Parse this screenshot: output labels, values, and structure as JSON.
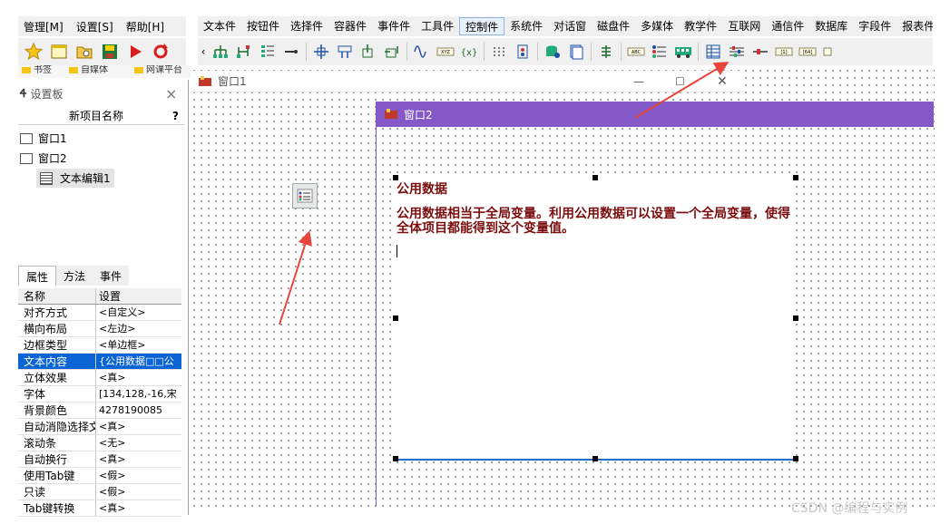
{
  "left_menu": [
    "管理[M]",
    "设置[S]",
    "帮助[H]"
  ],
  "left_toolbar_icons": [
    "star-icon",
    "window-icon",
    "open-folder-icon",
    "save-icon",
    "run-icon",
    "refresh-icon"
  ],
  "fav_strip": {
    "items": [
      "书签",
      "自媒体",
      "网课平台"
    ]
  },
  "main_menu": [
    "文本件",
    "按钮件",
    "选择件",
    "容器件",
    "事件件",
    "工具件",
    "控制件",
    "系统件",
    "对话窗",
    "磁盘件",
    "多媒体",
    "教学件",
    "互联网",
    "通信件",
    "数据库",
    "字段件",
    "报表件"
  ],
  "main_menu_active": "控制件",
  "panel": {
    "title": "设置板",
    "close": "×",
    "tree_header": "新项目名称",
    "tree_help": "?",
    "tree_items": [
      "窗口1",
      "窗口2",
      "文本编辑1"
    ],
    "tabs": [
      "属性",
      "方法",
      "事件"
    ],
    "prop_headers": {
      "name": "名称",
      "value": "设置"
    },
    "props": [
      {
        "name": "对齐方式",
        "value": "<自定义>"
      },
      {
        "name": "横向布局",
        "value": "<左边>"
      },
      {
        "name": "边框类型",
        "value": "<单边框>"
      },
      {
        "name": "文本内容",
        "value": "{公用数据□□公"
      },
      {
        "name": "立体效果",
        "value": "<真>"
      },
      {
        "name": "字体",
        "value": "[134,128,-16,宋"
      },
      {
        "name": "背景颜色",
        "value": "4278190085"
      },
      {
        "name": "自动消隐选择文",
        "value": "<真>"
      },
      {
        "name": "滚动条",
        "value": "<无>"
      },
      {
        "name": "自动换行",
        "value": "<真>"
      },
      {
        "name": "使用Tab键",
        "value": "<假>"
      },
      {
        "name": "只读",
        "value": "<假>"
      },
      {
        "name": "Tab键转换",
        "value": "<真>"
      }
    ]
  },
  "window1": {
    "title": "窗口1",
    "controls": [
      "—",
      "☐",
      "✕"
    ]
  },
  "window2": {
    "title": "窗口2"
  },
  "editor": {
    "title": "公用数据",
    "body": "公用数据相当于全局变量。利用公用数据可以设置一个全局变量，使得全体项目都能得到这个变量值。"
  },
  "watermark": "CSDN @编程与实例",
  "colors": {
    "window2_bar": "#8458c6",
    "editor_text": "#7a0d0d",
    "selected_row": "#0a64d4",
    "arrow": "#e8453c"
  }
}
